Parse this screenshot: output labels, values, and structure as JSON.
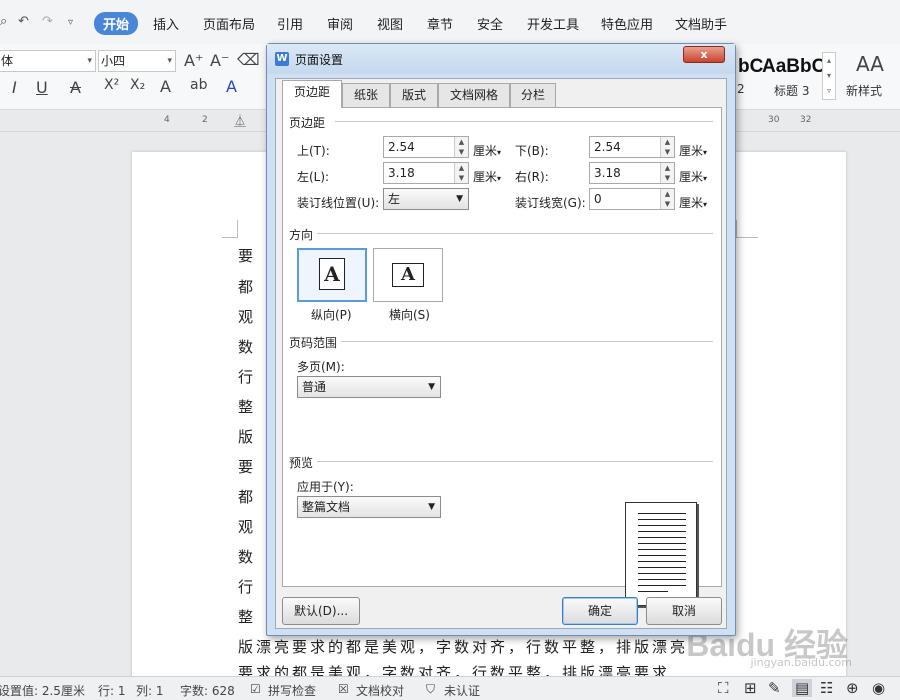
{
  "ribbon": {
    "tabs": [
      "开始",
      "插入",
      "页面布局",
      "引用",
      "审阅",
      "视图",
      "章节",
      "安全",
      "开发工具",
      "特色应用",
      "文档助手"
    ],
    "active_tab": "开始"
  },
  "toolbar": {
    "font_name": "体",
    "font_size": "小四",
    "style_preview_1": "bC",
    "style_preview_2": "AaBbC",
    "style_label_1": "2",
    "style_label_2": "标题 3",
    "new_style_label": "新样式"
  },
  "ruler": {
    "ticks": [
      "4",
      "2",
      "30",
      "32"
    ]
  },
  "document": {
    "lines": [
      "要 求",
      "都 是",
      "观 ，",
      "数 对",
      "行 数",
      "整 ，",
      "版 漂",
      "要 求",
      "都 是",
      "观 ，",
      "数 对",
      "行 数",
      "整 ，",
      "版漂亮要求的都是美观，字数对齐，行数平整，排版漂亮",
      "要求的都是美观，字数对齐，行数平整，排版漂亮要求"
    ]
  },
  "dialog": {
    "title": "页面设置",
    "close_label": "x",
    "tabs": [
      "页边距",
      "纸张",
      "版式",
      "文档网格",
      "分栏"
    ],
    "active_tab": "页边距",
    "margins": {
      "group": "页边距",
      "top_label": "上(T):",
      "top_value": "2.54",
      "bottom_label": "下(B):",
      "bottom_value": "2.54",
      "left_label": "左(L):",
      "left_value": "3.18",
      "right_label": "右(R):",
      "right_value": "3.18",
      "gutter_pos_label": "装订线位置(U):",
      "gutter_pos_value": "左",
      "gutter_width_label": "装订线宽(G):",
      "gutter_width_value": "0",
      "unit": "厘米"
    },
    "orientation": {
      "group": "方向",
      "portrait_label": "纵向(P)",
      "landscape_label": "横向(S)",
      "selected": "portrait",
      "glyph": "A"
    },
    "page_range": {
      "group": "页码范围",
      "multi_label": "多页(M):",
      "multi_value": "普通"
    },
    "preview": {
      "group": "预览",
      "apply_label": "应用于(Y):",
      "apply_value": "整篇文档"
    },
    "buttons": {
      "default": "默认(D)...",
      "ok": "确定",
      "cancel": "取消"
    }
  },
  "statusbar": {
    "setting": "设置值: 2.5厘米",
    "row": "行: 1",
    "col": "列: 1",
    "wordcount": "字数: 628",
    "spell": "拼写检查",
    "proof": "文档校对",
    "cert": "未认证"
  },
  "watermark": {
    "text": "Baidu 经验",
    "sub": "jingyan.baidu.com"
  }
}
